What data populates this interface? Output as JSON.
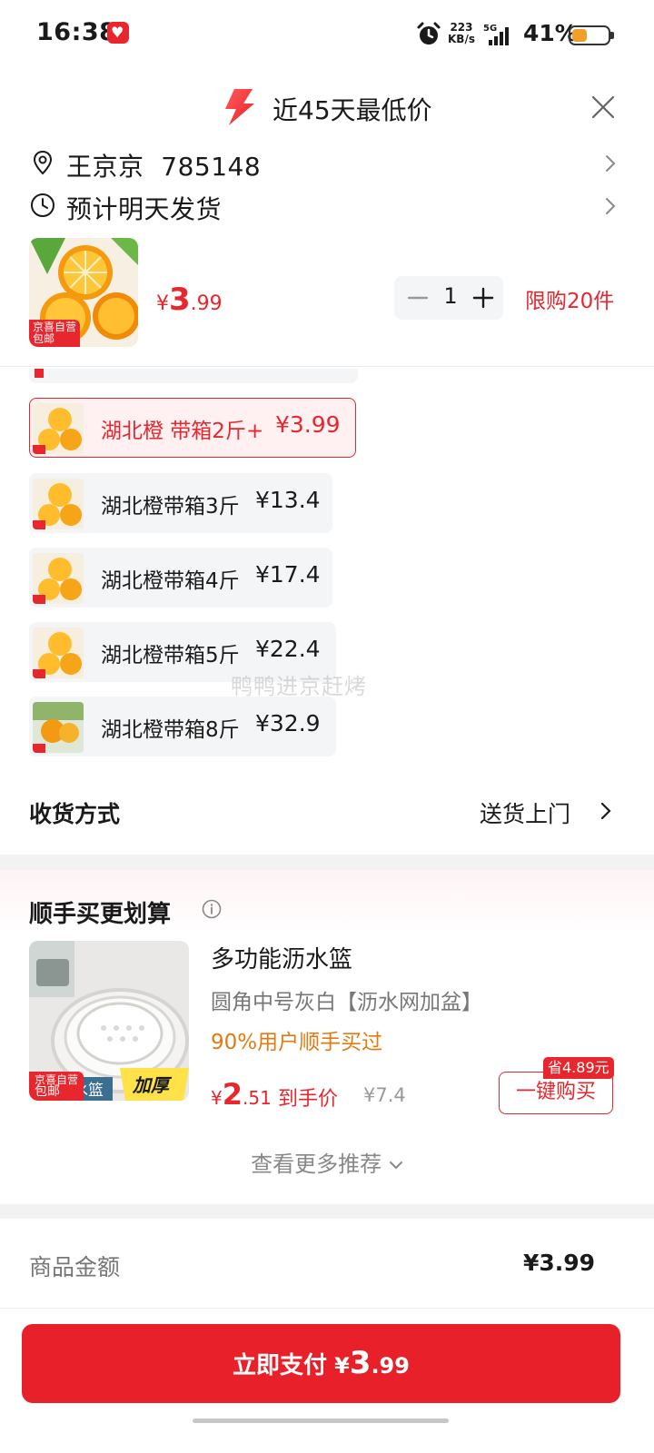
{
  "status_bar": {
    "time": "16:38",
    "net_speed_value": "223",
    "net_speed_unit": "KB/s",
    "network": "5G",
    "battery": "41%"
  },
  "header": {
    "title": "近45天最低价"
  },
  "address": {
    "name_code": "王京京  785148"
  },
  "delivery": {
    "text": "预计明天发货"
  },
  "product": {
    "badge_line1": "京喜自营",
    "badge_line2": "包邮",
    "price_symbol": "¥",
    "price_int": "3",
    "price_dec": ".99",
    "quantity": "1",
    "limit": "限购20件"
  },
  "variants": [
    {
      "name": "湖北橙 带箱2斤+",
      "price": "¥3.99",
      "selected": true
    },
    {
      "name": "湖北橙带箱3斤",
      "price": "¥13.4",
      "selected": false
    },
    {
      "name": "湖北橙带箱4斤",
      "price": "¥17.4",
      "selected": false
    },
    {
      "name": "湖北橙带箱5斤",
      "price": "¥22.4",
      "selected": false
    },
    {
      "name": "湖北橙带箱8斤",
      "price": "¥32.9",
      "selected": false
    }
  ],
  "watermark": "鸭鸭进京赶烤",
  "receive": {
    "label": "收货方式",
    "value": "送货上门"
  },
  "recommendation": {
    "title": "顺手买更划算",
    "item": {
      "name": "多功能沥水篮",
      "spec": "圆角中号灰白【沥水网加盆】",
      "tag": "90%用户顺手买过",
      "price_symbol": "¥",
      "price_int": "2",
      "price_dec": ".51",
      "after_label": "到手价",
      "original": "¥7.4",
      "save_badge": "省4.89元",
      "buy_label": "一键购买",
      "thumb_badge_line1": "京喜自营",
      "thumb_badge_line2": "包邮",
      "thumb_text1": "水篮",
      "thumb_text2": "加厚"
    },
    "more_label": "查看更多推荐"
  },
  "amount": {
    "label": "商品金额",
    "value": "¥3.99"
  },
  "pay": {
    "label": "立即支付",
    "symbol": "¥",
    "int": "3",
    "dec": ".99"
  },
  "colors": {
    "accent": "#e8262d",
    "tag_orange": "#e07b12"
  }
}
